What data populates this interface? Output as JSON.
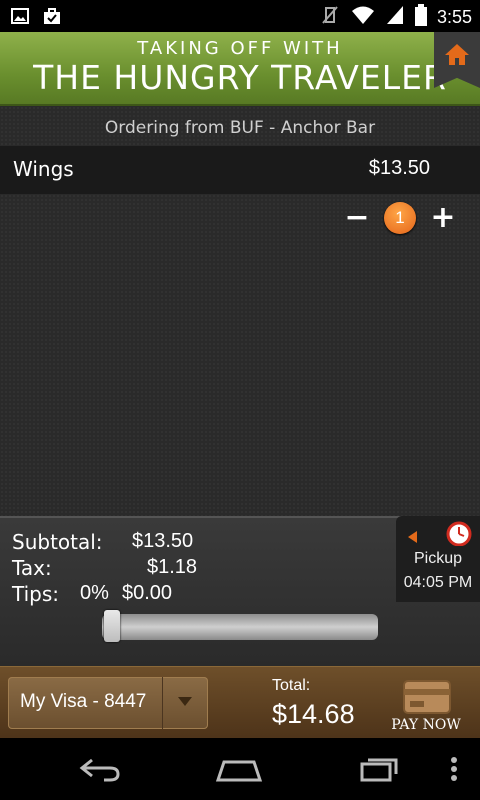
{
  "status_bar": {
    "time": "3:55",
    "left_icons": [
      "image-icon",
      "briefcase-icon"
    ],
    "right_icons": [
      "vibrate-off-icon",
      "wifi-icon",
      "signal-icon",
      "battery-icon"
    ]
  },
  "header": {
    "line1": "TAKING OFF WITH",
    "line2": "THE HUNGRY TRAVELER",
    "home_icon": "home-icon",
    "accent": "#e36a1a"
  },
  "order": {
    "ordering_from": "Ordering from  BUF - Anchor Bar",
    "items": [
      {
        "name": "Wings",
        "price": "$13.50",
        "quantity": "1"
      }
    ],
    "minus_symbol": "−",
    "plus_symbol": "+"
  },
  "totals": {
    "subtotal_label": "Subtotal:",
    "subtotal_value": "$13.50",
    "tax_label": "Tax:",
    "tax_value": "$1.18",
    "tips_label": "Tips:",
    "tips_percent": "0%",
    "tips_value": "$0.00",
    "tip_slider_fraction": 0
  },
  "pickup": {
    "label": "Pickup",
    "time": "04:05 PM",
    "icon": "clock-icon"
  },
  "footer": {
    "card": "My Visa - 8447",
    "total_label": "Total:",
    "total_value": "$14.68",
    "pay_label": "PAY NOW",
    "pay_icon": "wallet-icon"
  },
  "nav": {
    "icons": [
      "back-icon",
      "home-nav-icon",
      "recent-apps-icon",
      "overflow-menu-icon"
    ]
  }
}
